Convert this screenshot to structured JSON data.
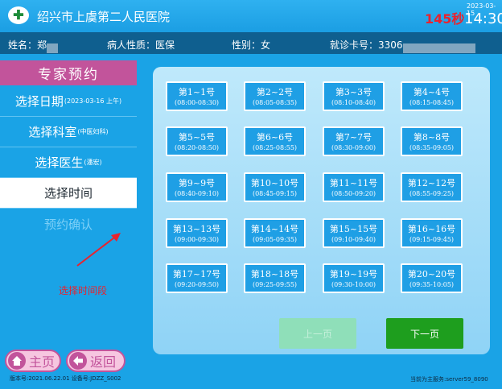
{
  "header": {
    "hospital_name": "绍兴市上虞第二人民医院",
    "countdown": "145秒",
    "date": "2023-03-15",
    "time": "14:30"
  },
  "patient": {
    "name_label": "姓名：",
    "name_value": "郑",
    "type_label": "病人性质：",
    "type_value": "医保",
    "gender_label": "性别：",
    "gender_value": "女",
    "card_label": "就诊卡号：",
    "card_value": "3306"
  },
  "menu": {
    "title": "专家预约",
    "items": [
      {
        "label": "选择日期",
        "sub": "(2023-03-16 上午)"
      },
      {
        "label": "选择科室",
        "sub": "(中医妇科)"
      },
      {
        "label": "选择医生",
        "sub": "(潘宏)"
      },
      {
        "label": "选择时间",
        "sub": ""
      },
      {
        "label": "预约确认",
        "sub": ""
      }
    ],
    "hint": "选择时间段"
  },
  "slots": [
    {
      "number": "第1~1号",
      "time": "(08:00-08:30)"
    },
    {
      "number": "第2~2号",
      "time": "(08:05-08:35)"
    },
    {
      "number": "第3~3号",
      "time": "(08:10-08:40)"
    },
    {
      "number": "第4~4号",
      "time": "(08:15-08:45)"
    },
    {
      "number": "第5~5号",
      "time": "(08:20-08:50)"
    },
    {
      "number": "第6~6号",
      "time": "(08:25-08:55)"
    },
    {
      "number": "第7~7号",
      "time": "(08:30-09:00)"
    },
    {
      "number": "第8~8号",
      "time": "(08:35-09:05)"
    },
    {
      "number": "第9~9号",
      "time": "(08:40-09:10)"
    },
    {
      "number": "第10~10号",
      "time": "(08:45-09:15)"
    },
    {
      "number": "第11~11号",
      "time": "(08:50-09:20)"
    },
    {
      "number": "第12~12号",
      "time": "(08:55-09:25)"
    },
    {
      "number": "第13~13号",
      "time": "(09:00-09:30)"
    },
    {
      "number": "第14~14号",
      "time": "(09:05-09:35)"
    },
    {
      "number": "第15~15号",
      "time": "(09:10-09:40)"
    },
    {
      "number": "第16~16号",
      "time": "(09:15-09:45)"
    },
    {
      "number": "第17~17号",
      "time": "(09:20-09:50)"
    },
    {
      "number": "第18~18号",
      "time": "(09:25-09:55)"
    },
    {
      "number": "第19~19号",
      "time": "(09:30-10:00)"
    },
    {
      "number": "第20~20号",
      "time": "(09:35-10:05)"
    }
  ],
  "pager": {
    "prev_label": "上一页",
    "next_label": "下一页"
  },
  "nav": {
    "home_label": "主页",
    "back_label": "返回"
  },
  "footer": {
    "left": "版本号:2021.06.22.01    设备号:JDZZ_S002",
    "right": "当前为主服务:server59_8090"
  },
  "colors": {
    "accent": "#c2549b",
    "countdown": "#e8232e",
    "next_button": "#1e9e1e"
  }
}
